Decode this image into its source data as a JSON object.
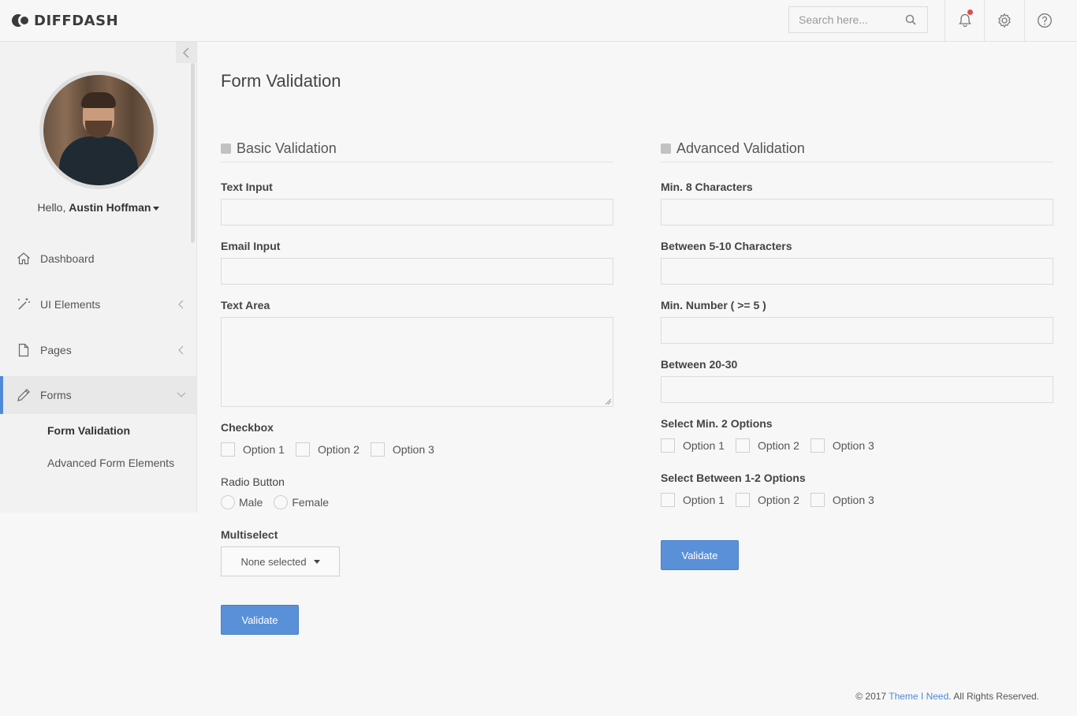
{
  "brand": {
    "logo_text": "DIFFDASH"
  },
  "header": {
    "search_placeholder": "Search here...",
    "notifications_icon": "bell-icon",
    "settings_icon": "gear-icon",
    "help_icon": "help-icon"
  },
  "sidebar": {
    "greeting": "Hello,",
    "user_name": "Austin Hoffman",
    "items": [
      {
        "label": "Dashboard",
        "icon": "home-icon"
      },
      {
        "label": "UI Elements",
        "icon": "magic-wand-icon"
      },
      {
        "label": "Pages",
        "icon": "page-icon"
      },
      {
        "label": "Forms",
        "icon": "pencil-icon"
      }
    ],
    "sub_items": [
      {
        "label": "Form Validation"
      },
      {
        "label": "Advanced Form Elements"
      }
    ]
  },
  "page": {
    "title": "Form Validation"
  },
  "basic": {
    "heading": "Basic Validation",
    "text_input_label": "Text Input",
    "email_input_label": "Email Input",
    "text_area_label": "Text Area",
    "checkbox_label": "Checkbox",
    "checkbox_options": [
      "Option 1",
      "Option 2",
      "Option 3"
    ],
    "radio_label": "Radio Button",
    "radio_options": [
      "Male",
      "Female"
    ],
    "multiselect_label": "Multiselect",
    "multiselect_value": "None selected",
    "validate_label": "Validate"
  },
  "advanced": {
    "heading": "Advanced Validation",
    "min8_label": "Min. 8 Characters",
    "between5_10_label": "Between 5-10 Characters",
    "min_number_label": "Min. Number ( >= 5 )",
    "between20_30_label": "Between 20-30",
    "select_min2_label": "Select Min. 2 Options",
    "select_min2_options": [
      "Option 1",
      "Option 2",
      "Option 3"
    ],
    "select_1_2_label": "Select Between 1-2 Options",
    "select_1_2_options": [
      "Option 1",
      "Option 2",
      "Option 3"
    ],
    "validate_label": "Validate"
  },
  "footer": {
    "prefix": "© 2017",
    "link": "Theme I Need",
    "suffix": ". All Rights Reserved."
  },
  "colors": {
    "accent": "#5a90d8",
    "notification_dot": "#e04b4b"
  }
}
